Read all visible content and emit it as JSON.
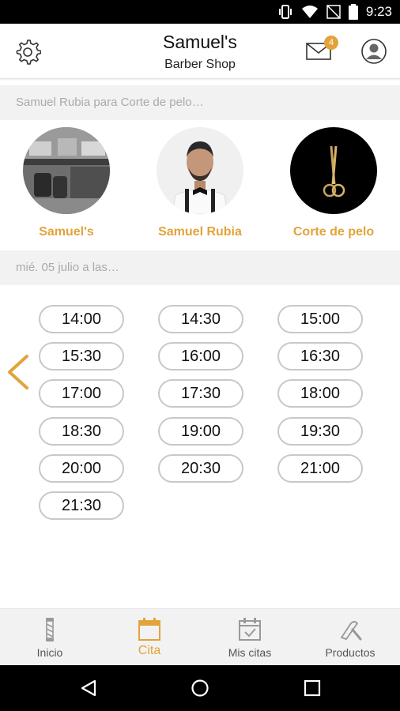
{
  "statusbar": {
    "time": "9:23"
  },
  "header": {
    "title": "Samuel's",
    "subtitle": "Barber Shop",
    "mail_badge": "4"
  },
  "selection_prompt": "Samuel Rubia para Corte de pelo…",
  "staff": [
    {
      "label": "Samuel's",
      "icon": "shop-photo"
    },
    {
      "label": "Samuel Rubia",
      "icon": "barber-photo"
    },
    {
      "label": "Corte de pelo",
      "icon": "scissors-icon"
    }
  ],
  "date_prompt": "mié. 05 julio a las…",
  "time_slots": [
    "14:00",
    "14:30",
    "15:00",
    "15:30",
    "16:00",
    "16:30",
    "17:00",
    "17:30",
    "18:00",
    "18:30",
    "19:00",
    "19:30",
    "20:00",
    "20:30",
    "21:00",
    "21:30"
  ],
  "bottom_nav": [
    {
      "label": "Inicio",
      "icon": "barber-pole-icon",
      "active": false
    },
    {
      "label": "Cita",
      "icon": "calendar-icon",
      "active": true
    },
    {
      "label": "Mis citas",
      "icon": "calendar-check-icon",
      "active": false
    },
    {
      "label": "Productos",
      "icon": "razor-icon",
      "active": false
    }
  ],
  "colors": {
    "accent": "#e2a33b",
    "slot_border": "#c8c8c8",
    "section_bg": "#f2f2f2"
  }
}
